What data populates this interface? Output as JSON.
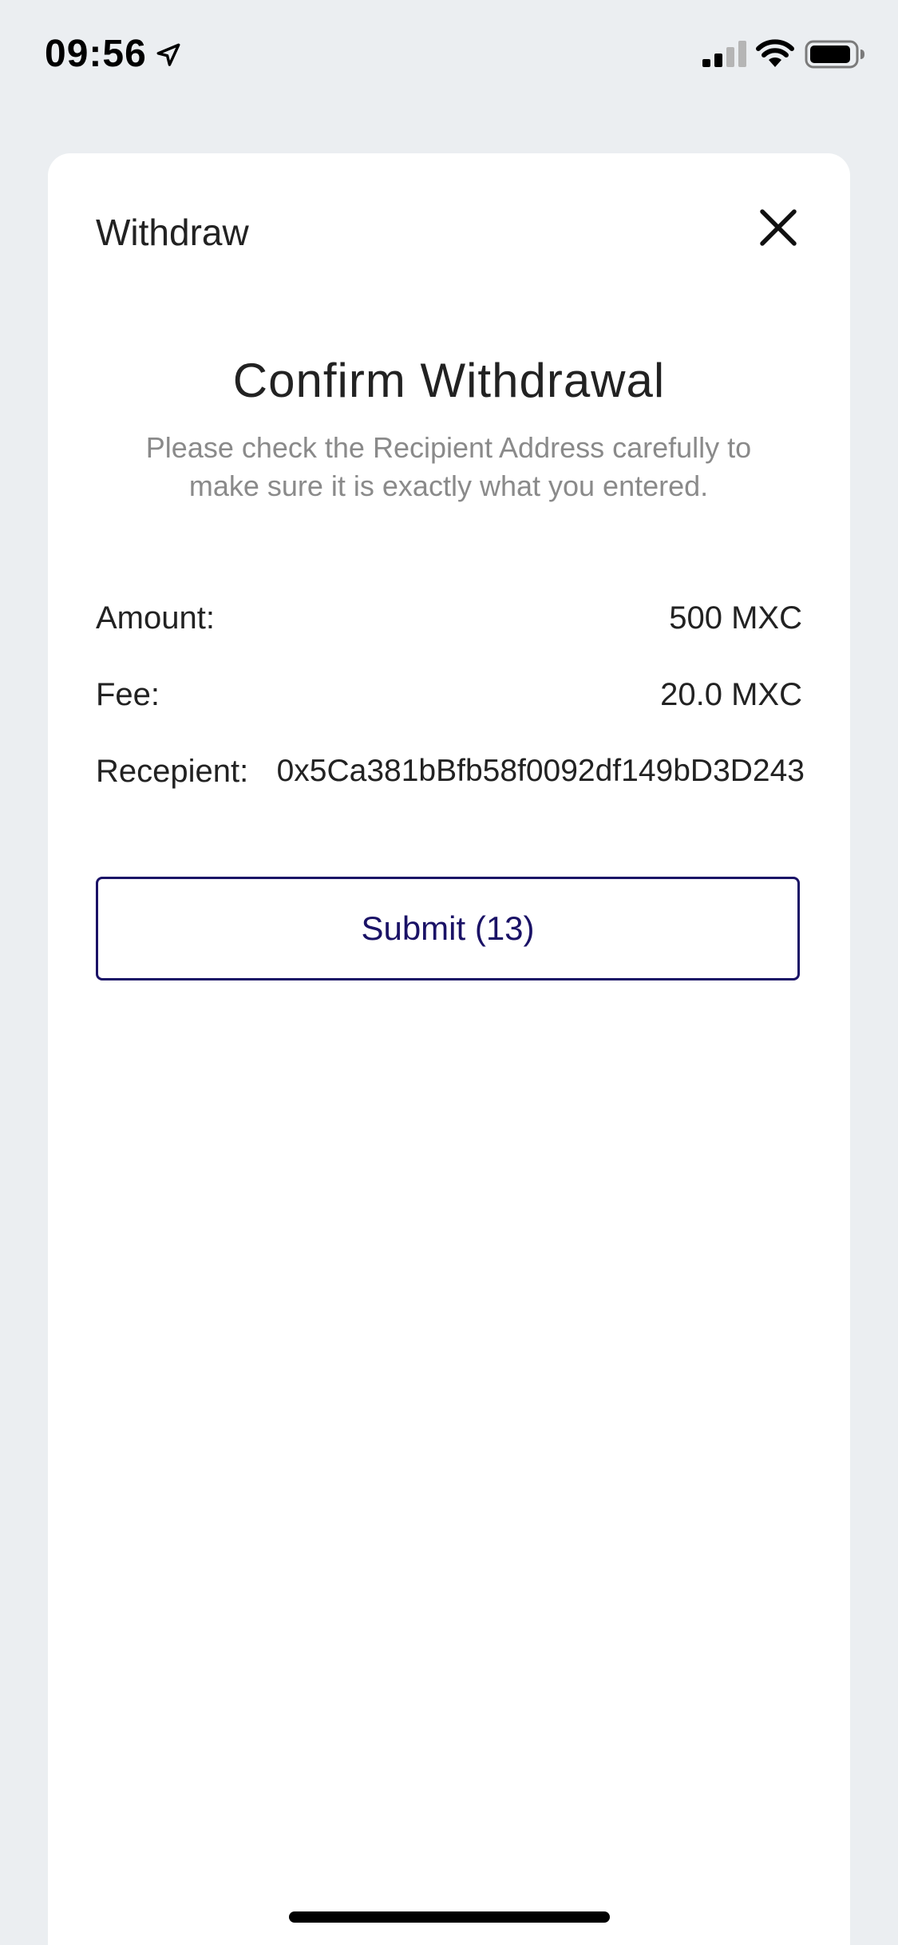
{
  "status_bar": {
    "time": "09:56",
    "icons": [
      "location-arrow-icon",
      "cellular-signal-icon",
      "wifi-icon",
      "battery-icon"
    ]
  },
  "sheet": {
    "title": "Withdraw",
    "close_icon": "close-icon"
  },
  "confirm": {
    "heading": "Confirm Withdrawal",
    "subtitle": "Please check the Recipient Address carefully to make sure it is exactly what you entered."
  },
  "details": {
    "amount_label": "Amount:",
    "amount_value": "500 MXC",
    "fee_label": "Fee:",
    "fee_value": "20.0 MXC",
    "recipient_label": "Recepient:",
    "recipient_value": "0x5Ca381bBfb58f0092df149bD3D243"
  },
  "actions": {
    "submit_label": "Submit (13)"
  },
  "colors": {
    "background": "#ebeef1",
    "card": "#ffffff",
    "accent": "#1a1266",
    "text_primary": "#222222",
    "text_secondary": "#8a8a8a"
  }
}
